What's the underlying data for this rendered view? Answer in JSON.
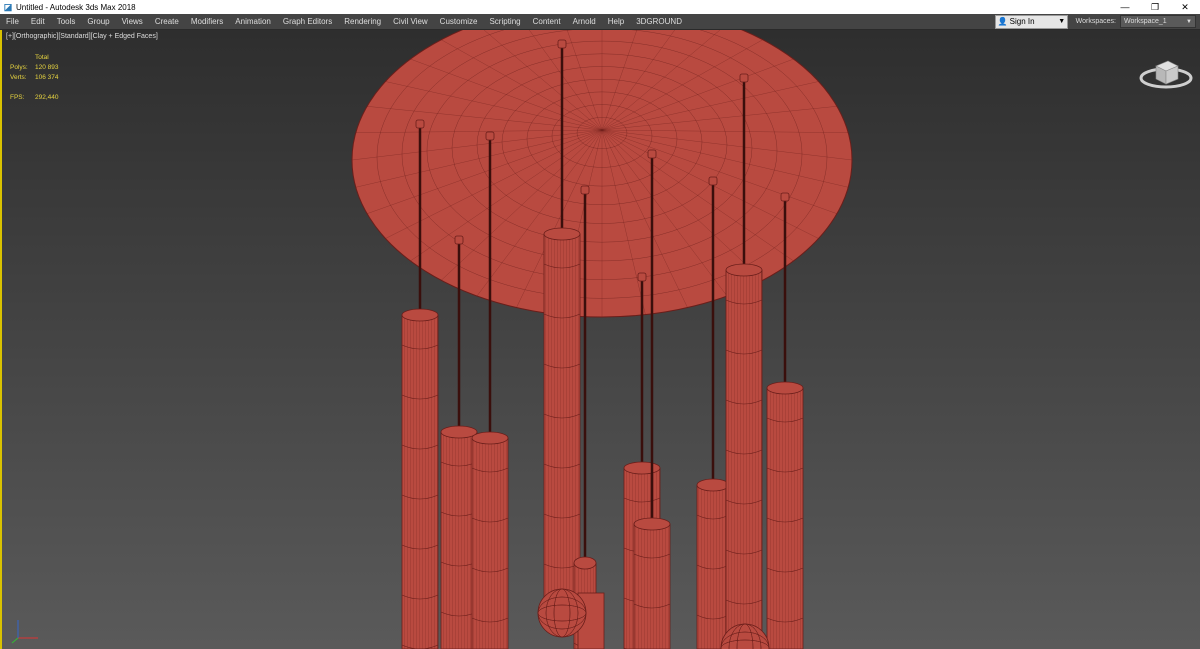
{
  "window": {
    "title": "Untitled - Autodesk 3ds Max 2018",
    "controls": [
      "minimize-icon",
      "restore-icon",
      "close-icon"
    ]
  },
  "menu": {
    "items": [
      "File",
      "Edit",
      "Tools",
      "Group",
      "Views",
      "Create",
      "Modifiers",
      "Animation",
      "Graph Editors",
      "Rendering",
      "Civil View",
      "Customize",
      "Scripting",
      "Content",
      "Arnold",
      "Help",
      "3DGROUND"
    ],
    "signin_label": "Sign In",
    "workspaces_label": "Workspaces:",
    "workspace_value": "Workspace_1"
  },
  "viewport": {
    "labels": [
      "[+]",
      "[Orthographic]",
      "[Standard]",
      "[Clay + Edged Faces]"
    ],
    "stats": {
      "header": "Total",
      "polys_label": "Polys:",
      "polys_value": "120 893",
      "verts_label": "Verts:",
      "verts_value": "106 374",
      "fps_label": "FPS:",
      "fps_value": "292,440"
    },
    "model_color": "#b94a40",
    "wire_color": "#6a1e1a",
    "viewcube_icon": "viewcube-icon",
    "axis_icon": "axis-tripod-icon"
  }
}
